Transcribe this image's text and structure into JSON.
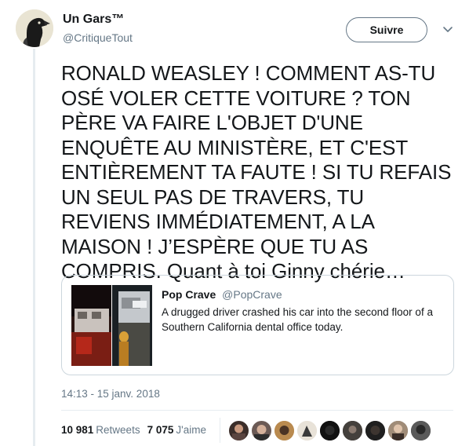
{
  "author": {
    "name": "Un Gars™",
    "handle": "@CritiqueTout",
    "avatar_icon": "raven-avatar-icon"
  },
  "follow_button": {
    "label": "Suivre"
  },
  "menu_icon": "chevron-down-icon",
  "tweet": {
    "text": "RONALD WEASLEY ! COMMENT AS-TU OSÉ VOLER CETTE VOITURE ? TON PÈRE VA FAIRE L'OBJET D'UNE ENQUÊTE AU MINISTÈRE, ET C'EST ENTIÈREMENT TA FAUTE ! SI TU REFAIS UN SEUL PAS DE TRAVERS, TU REVIENS IMMÉDIATEMENT, A LA MAISON ! J’ESPÈRE QUE TU AS COMPRIS. Quant à toi Ginny chérie…"
  },
  "quote": {
    "name": "Pop Crave",
    "handle": "@PopCrave",
    "text": "A drugged driver crashed his car into the second floor of a Southern California dental office today.",
    "media_icon": "car-crash-photo"
  },
  "timestamp": "14:13 - 15 janv. 2018",
  "stats": {
    "retweets_count": "10 981",
    "retweets_label": "Retweets",
    "likes_count": "7 075",
    "likes_label": "J'aime"
  },
  "colors": {
    "text": "#14171a",
    "secondary": "#657786",
    "border": "#ccd6dd",
    "divider": "#e6ecf0"
  }
}
